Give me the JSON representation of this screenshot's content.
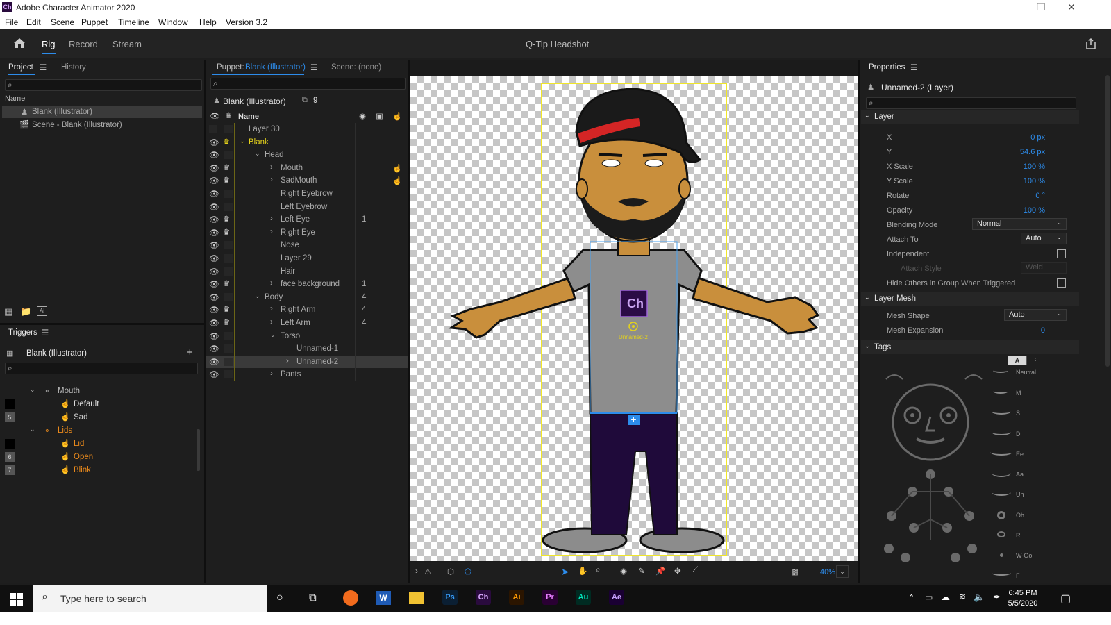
{
  "window": {
    "title": "Adobe Character Animator 2020",
    "logo": "Ch"
  },
  "menu": [
    "File",
    "Edit",
    "Scene",
    "Puppet",
    "Timeline",
    "Window",
    "Help",
    "Version 3.2"
  ],
  "header": {
    "tabs": [
      "Rig",
      "Record",
      "Stream"
    ],
    "active_tab": "Rig",
    "document_title": "Q-Tip Headshot"
  },
  "project": {
    "tabs": [
      "Project",
      "History"
    ],
    "column_name": "Name",
    "items": [
      "Blank (Illustrator)",
      "Scene - Blank (Illustrator)"
    ]
  },
  "puppet": {
    "label": "Puppet:",
    "puppet_name": "Blank (Illustrator)",
    "scene_label": "Scene: (none)",
    "title": "Blank (Illustrator)",
    "count": "9",
    "column_name": "Name",
    "layers": [
      {
        "name": "Layer 30",
        "num": ""
      },
      {
        "name": "Blank",
        "num": ""
      },
      {
        "name": "Head",
        "num": ""
      },
      {
        "name": "Mouth",
        "num": ""
      },
      {
        "name": "SadMouth",
        "num": ""
      },
      {
        "name": "Right Eyebrow",
        "num": ""
      },
      {
        "name": "Left Eyebrow",
        "num": ""
      },
      {
        "name": "Left Eye",
        "num": "1"
      },
      {
        "name": "Right Eye",
        "num": ""
      },
      {
        "name": "Nose",
        "num": ""
      },
      {
        "name": "Layer 29",
        "num": ""
      },
      {
        "name": "Hair",
        "num": ""
      },
      {
        "name": "face background",
        "num": "1"
      },
      {
        "name": "Body",
        "num": "4"
      },
      {
        "name": "Right Arm",
        "num": "4"
      },
      {
        "name": "Left Arm",
        "num": "4"
      },
      {
        "name": "Torso",
        "num": ""
      },
      {
        "name": "Unnamed-1",
        "num": ""
      },
      {
        "name": "Unnamed-2",
        "num": ""
      },
      {
        "name": "Pants",
        "num": ""
      }
    ]
  },
  "triggers": {
    "title": "Triggers",
    "puppet": "Blank (Illustrator)",
    "items": [
      {
        "key": "",
        "name": "Mouth"
      },
      {
        "key": "",
        "name": "Default"
      },
      {
        "key": "5",
        "name": "Sad"
      },
      {
        "key": "",
        "name": "Lids"
      },
      {
        "key": "",
        "name": "Lid"
      },
      {
        "key": "6",
        "name": "Open"
      },
      {
        "key": "7",
        "name": "Blink"
      }
    ]
  },
  "canvas": {
    "layer_label": "Unnamed-2",
    "badge": "Ch",
    "zoom": "40%"
  },
  "properties": {
    "title": "Properties",
    "layer_name": "Unnamed-2 (Layer)",
    "section_layer": "Layer",
    "rows": [
      {
        "label": "X",
        "value": "0 px"
      },
      {
        "label": "Y",
        "value": "54.6 px"
      },
      {
        "label": "X Scale",
        "value": "100 %"
      },
      {
        "label": "Y Scale",
        "value": "100 %"
      },
      {
        "label": "Rotate",
        "value": "0 °"
      },
      {
        "label": "Opacity",
        "value": "100 %"
      }
    ],
    "blending_mode_label": "Blending Mode",
    "blending_mode": "Normal",
    "attach_to_label": "Attach To",
    "attach_to": "Auto",
    "independent_label": "Independent",
    "attach_style_label": "Attach Style",
    "attach_style": "Weld",
    "hide_others_label": "Hide Others in Group When Triggered",
    "section_mesh": "Layer Mesh",
    "mesh_shape_label": "Mesh Shape",
    "mesh_shape": "Auto",
    "mesh_expansion_label": "Mesh Expansion",
    "mesh_expansion": "0",
    "section_tags": "Tags",
    "tag_toggle": "A",
    "mouth_tags": [
      "Neutral",
      "M",
      "S",
      "D",
      "Ee",
      "Aa",
      "Uh",
      "Oh",
      "R",
      "W-Oo",
      "F"
    ]
  },
  "taskbar": {
    "search_placeholder": "Type here to search",
    "time": "6:45 PM",
    "date": "5/5/2020",
    "apps": [
      "Ps",
      "Ch",
      "Ai",
      "Pr",
      "Au",
      "Ae"
    ],
    "word": "W"
  },
  "colors": {
    "accent": "#2d8ceb",
    "orange": "#e8891c",
    "yellow": "#e5d21b"
  }
}
